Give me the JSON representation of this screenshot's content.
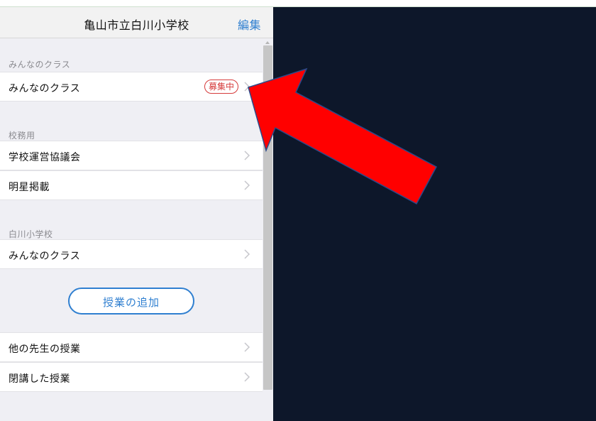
{
  "navbar": {
    "title": "亀山市立白川小学校",
    "edit_label": "編集"
  },
  "sections": {
    "minna": {
      "header": "みんなのクラス",
      "row_label": "みんなのクラス",
      "badge": "募集中"
    },
    "koumu": {
      "header": "校務用",
      "row1_label": "学校運営協議会",
      "row2_label": "明星掲載"
    },
    "shirakawa": {
      "header": "白川小学校",
      "row_label": "みんなのクラス"
    }
  },
  "add_class_button": "授業の追加",
  "bottom_rows": {
    "other_teachers": "他の先生の授業",
    "closed_classes": "閉講した授業"
  },
  "colors": {
    "accent": "#2f7fd0",
    "badge": "#d63b3b",
    "arrow_fill": "#ff0000",
    "arrow_stroke": "#2b4a8a",
    "detail_bg": "#0d172a"
  },
  "icons": {
    "chevron": "chevron-right-icon",
    "arrow": "red-arrow-annotation"
  }
}
